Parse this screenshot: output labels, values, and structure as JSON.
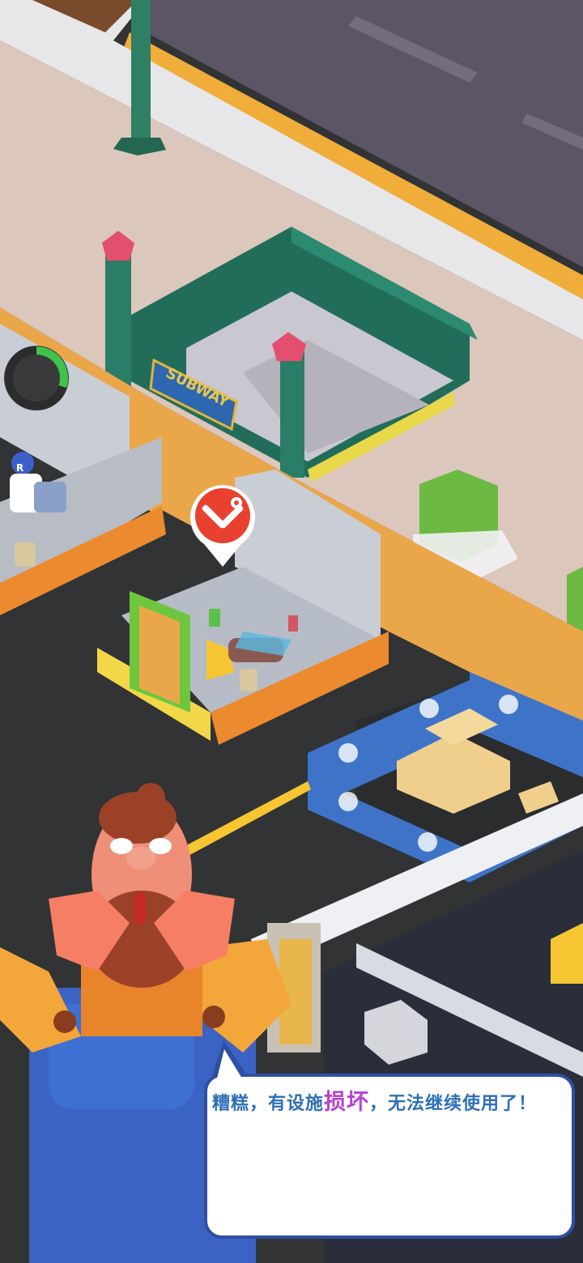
{
  "scene": {
    "subway_sign": "SUBWAY",
    "cleaner_cap_letter": "R"
  },
  "colors": {
    "road": "#5b5566",
    "sidewalk": "#dcc7bd",
    "road_line": "#f0ad3a",
    "railing": "#2f8a6e",
    "wall_orange": "#eaa74a",
    "tile": "#c9ced6",
    "floor": "#2f3133",
    "door_green": "#5bbd3a",
    "repair_red": "#e8412f",
    "dialog_border": "#2f4fa3",
    "dialog_text": "#2e6fb8",
    "dialog_highlight": "#b83fd6"
  },
  "icons": {
    "repair": "wrench-screwdriver-icon",
    "timer": "progress-ring-icon",
    "lock": "padlock-icon"
  },
  "timer": {
    "progress": 0.3
  },
  "dialog": {
    "text_before": "糟糕，有设施",
    "text_highlight": "损坏",
    "text_after": "，无法继续使用了！"
  }
}
